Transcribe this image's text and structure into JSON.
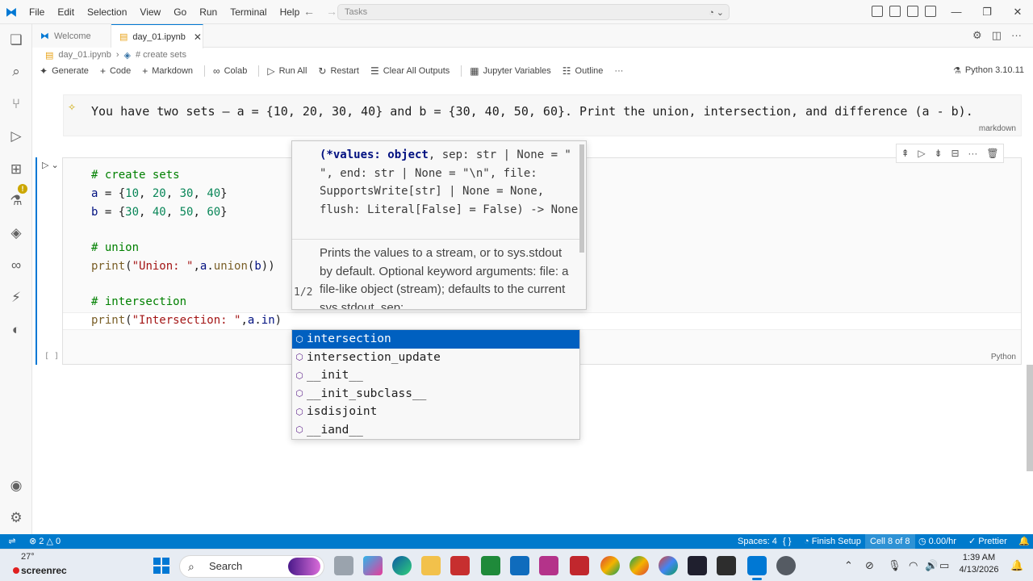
{
  "menu": [
    "File",
    "Edit",
    "Selection",
    "View",
    "Go",
    "Run",
    "Terminal",
    "Help"
  ],
  "command_center": {
    "placeholder": "Tasks"
  },
  "tabs": [
    {
      "label": "Welcome",
      "icon": "vscode-icon",
      "active": false
    },
    {
      "label": "day_01.ipynb",
      "icon": "notebook-icon",
      "active": true
    }
  ],
  "breadcrumb": {
    "file": "day_01.ipynb",
    "symbol": "# create sets"
  },
  "toolbar": {
    "generate": "Generate",
    "code": "Code",
    "markdown": "Markdown",
    "colab": "Colab",
    "run_all": "Run All",
    "restart": "Restart",
    "clear_outputs": "Clear All Outputs",
    "jupyter_variables": "Jupyter Variables",
    "outline": "Outline",
    "more": "···",
    "kernel": "Python 3.10.11"
  },
  "markdown_cell": {
    "text": "You have two sets — a = {10, 20, 30, 40} and b = {30, 40, 50, 60}. Print the union, intersection, and difference (a - b).",
    "language": "markdown"
  },
  "code_cell": {
    "execution_count": "[ ]",
    "language": "Python",
    "lines": {
      "l1": "# create sets",
      "l2a": "a",
      "l2b": " = {",
      "l2c": "10",
      "l2d": ", ",
      "l2e": "20",
      "l2f": ", ",
      "l2g": "30",
      "l2h": ", ",
      "l2i": "40",
      "l2j": "}",
      "l3a": "b",
      "l3b": " = {",
      "l3c": "30",
      "l3d": ", ",
      "l3e": "40",
      "l3f": ", ",
      "l3g": "50",
      "l3h": ", ",
      "l3i": "60",
      "l3j": "}",
      "l5": "# union",
      "l6a": "print",
      "l6b": "(",
      "l6c": "\"Union: \"",
      "l6d": ",",
      "l6e": "a",
      "l6f": ".",
      "l6g": "union",
      "l6h": "(",
      "l6i": "b",
      "l6j": "))",
      "l8": "# intersection",
      "l9a": "print",
      "l9b": "(",
      "l9c": "\"Intersection: \"",
      "l9d": ",",
      "l9e": "a",
      "l9f": ".",
      "l9g": "in",
      "l9h": ")"
    }
  },
  "param_hint": {
    "signature_bold": "(*values: object",
    "signature_rest": ", sep: str | None = \" \", end: str | None = \"\\n\", file: SupportsWrite[str] | None = None, flush: Literal[False] = False) -> None",
    "doc": "Prints the values to a stream, or to sys.stdout by default. Optional keyword arguments: file: a file-like object (stream); defaults to the current sys.stdout. sep:",
    "counter": "1/2"
  },
  "suggestions": [
    "intersection",
    "intersection_update",
    "__init__",
    "__init_subclass__",
    "isdisjoint",
    "__iand__"
  ],
  "status": {
    "errors": "2",
    "warnings": "0",
    "spaces": "Spaces: 4",
    "braces": "{ }",
    "finish_setup": "Finish Setup",
    "cell": "Cell 8 of 8",
    "rate": "0.00/hr",
    "prettier": "Prettier"
  },
  "taskbar": {
    "weather": "27°",
    "screenrec": "screenrec",
    "search": "Search",
    "time": "1:39 AM",
    "date": "4/13/2026"
  },
  "colors": {
    "accent": "#0078d4",
    "statusbar": "#007acc",
    "selection": "#0060c0"
  }
}
